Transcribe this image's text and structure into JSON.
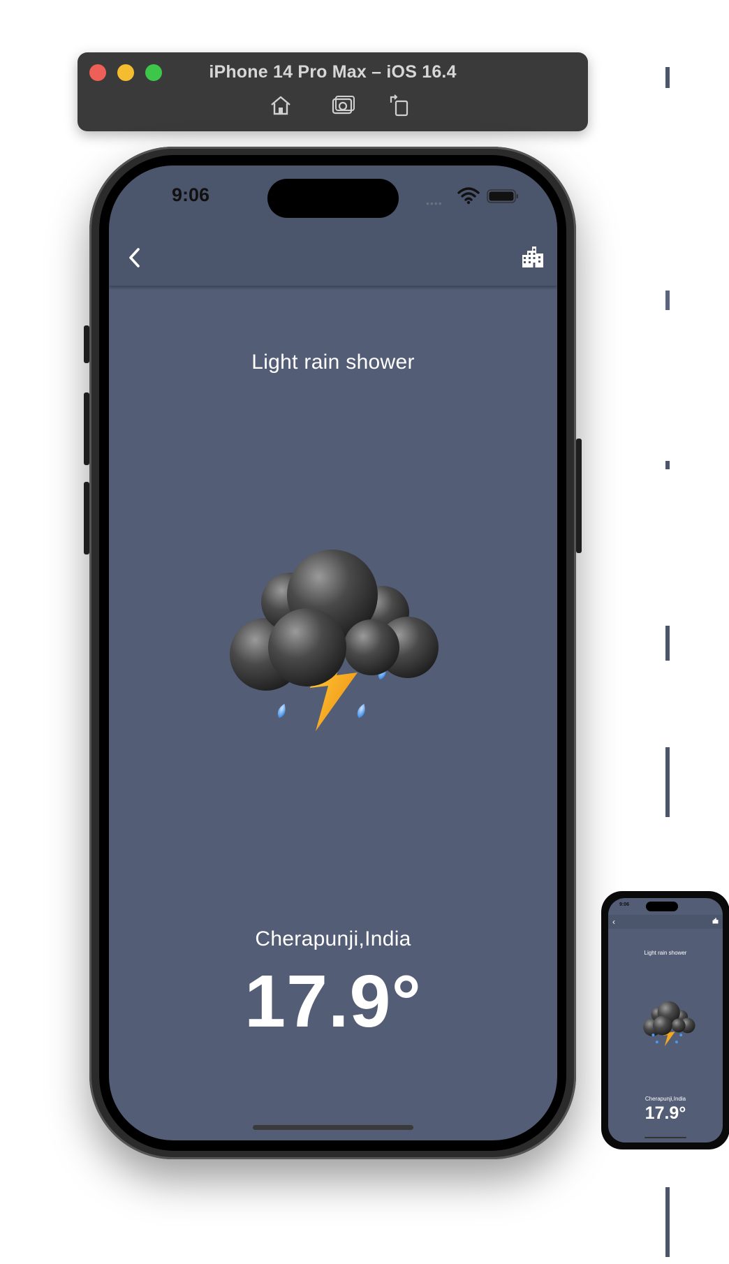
{
  "simulator": {
    "window_title": "iPhone 14 Pro Max – iOS 16.4",
    "toolbar": {
      "home_icon": "home-icon",
      "screenshot_icon": "screenshot-icon",
      "rotate_icon": "rotate-icon"
    }
  },
  "status_bar": {
    "time": "9:06",
    "signal": "••••"
  },
  "app_bar": {
    "back_icon": "chevron-left-icon",
    "city_icon": "city-icon"
  },
  "weather": {
    "condition": "Light rain shower",
    "icon": "thunderstorm-cloud-icon",
    "location": "Cherapunji,India",
    "temperature": "17.9°"
  },
  "mini_preview": {
    "time": "9:06",
    "condition": "Light rain shower",
    "location": "Cherapunji,India",
    "temperature": "17.9°"
  },
  "colors": {
    "screen_bg": "#535d76",
    "app_bar_bg": "#4b556c",
    "text": "#ffffff"
  }
}
